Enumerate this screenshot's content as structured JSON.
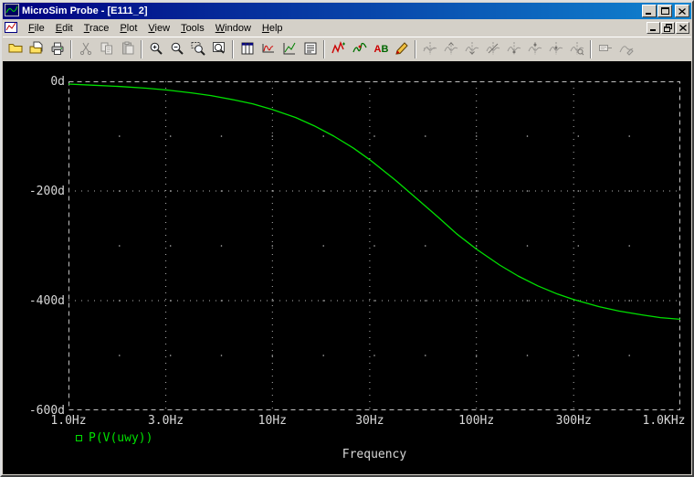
{
  "window": {
    "title": "MicroSim Probe - [E111_2]"
  },
  "menu": {
    "items": [
      "File",
      "Edit",
      "Trace",
      "Plot",
      "View",
      "Tools",
      "Window",
      "Help"
    ]
  },
  "toolbar": {
    "groups": [
      {
        "items": [
          {
            "name": "open",
            "icon": "open-folder"
          },
          {
            "name": "open-file",
            "icon": "open-file"
          },
          {
            "name": "print",
            "icon": "print"
          }
        ]
      },
      {
        "items": [
          {
            "name": "cut",
            "icon": "cut",
            "enabled": false
          },
          {
            "name": "copy",
            "icon": "copy",
            "enabled": false
          },
          {
            "name": "paste",
            "icon": "paste",
            "enabled": false
          }
        ]
      },
      {
        "items": [
          {
            "name": "zoom-in",
            "icon": "zoom-in"
          },
          {
            "name": "zoom-out",
            "icon": "zoom-out"
          },
          {
            "name": "zoom-area",
            "icon": "zoom-area"
          },
          {
            "name": "zoom-fit",
            "icon": "zoom-fit"
          }
        ]
      },
      {
        "items": [
          {
            "name": "plot-columns",
            "icon": "columns"
          },
          {
            "name": "fourier",
            "icon": "fourier"
          },
          {
            "name": "performance-analysis",
            "icon": "xy"
          },
          {
            "name": "data-list",
            "icon": "list"
          }
        ]
      },
      {
        "items": [
          {
            "name": "add-trace",
            "icon": "trace-red"
          },
          {
            "name": "eval-goal-function",
            "icon": "trace-goal"
          },
          {
            "name": "text-label",
            "icon": "ab"
          },
          {
            "name": "mark-point",
            "icon": "pencil"
          }
        ]
      },
      {
        "items": [
          {
            "name": "toggle-cursor",
            "icon": "cursor-toggle",
            "enabled": false
          },
          {
            "name": "cursor-peak",
            "icon": "cursor-peak",
            "enabled": false
          },
          {
            "name": "cursor-trough",
            "icon": "cursor-trough",
            "enabled": false
          },
          {
            "name": "cursor-slope",
            "icon": "cursor-slope",
            "enabled": false
          },
          {
            "name": "cursor-min",
            "icon": "cursor-min",
            "enabled": false
          },
          {
            "name": "cursor-max",
            "icon": "cursor-max",
            "enabled": false
          },
          {
            "name": "cursor-point",
            "icon": "cursor-point",
            "enabled": false
          },
          {
            "name": "cursor-search",
            "icon": "cursor-search",
            "enabled": false
          }
        ]
      },
      {
        "items": [
          {
            "name": "label-point",
            "icon": "tag",
            "enabled": false
          },
          {
            "name": "mark-voltage",
            "icon": "probe-mark",
            "enabled": false
          }
        ]
      }
    ]
  },
  "chart_data": {
    "type": "line",
    "title": "",
    "xlabel": "Frequency",
    "ylabel": "",
    "x_scale": "log",
    "xlim": [
      1,
      1000
    ],
    "ylim": [
      -600,
      0
    ],
    "grid": "dotted",
    "legend_position": "bottom-left",
    "x_ticks": [
      {
        "v": 1,
        "label": "1.0Hz"
      },
      {
        "v": 3,
        "label": "3.0Hz"
      },
      {
        "v": 10,
        "label": "10Hz"
      },
      {
        "v": 30,
        "label": "30Hz"
      },
      {
        "v": 100,
        "label": "100Hz"
      },
      {
        "v": 300,
        "label": "300Hz"
      },
      {
        "v": 1000,
        "label": "1.0KHz"
      }
    ],
    "y_ticks": [
      {
        "v": 0,
        "label": "0d"
      },
      {
        "v": -200,
        "label": "-200d"
      },
      {
        "v": -400,
        "label": "-400d"
      },
      {
        "v": -600,
        "label": "-600d"
      }
    ],
    "series": [
      {
        "name": "P(V(uwy))",
        "color": "#00e000",
        "points": [
          [
            1,
            -5
          ],
          [
            1.3,
            -7
          ],
          [
            1.8,
            -9.5
          ],
          [
            2.4,
            -12.5
          ],
          [
            3,
            -15.6
          ],
          [
            4,
            -21
          ],
          [
            5,
            -26
          ],
          [
            6.5,
            -34
          ],
          [
            8,
            -41
          ],
          [
            10,
            -51.5
          ],
          [
            13,
            -66
          ],
          [
            16,
            -81
          ],
          [
            20,
            -100
          ],
          [
            25,
            -122
          ],
          [
            30,
            -143
          ],
          [
            40,
            -180
          ],
          [
            50,
            -211
          ],
          [
            65,
            -248
          ],
          [
            80,
            -278
          ],
          [
            100,
            -306
          ],
          [
            130,
            -335
          ],
          [
            160,
            -355
          ],
          [
            200,
            -373
          ],
          [
            250,
            -388
          ],
          [
            300,
            -398
          ],
          [
            400,
            -411
          ],
          [
            500,
            -419
          ],
          [
            650,
            -426
          ],
          [
            800,
            -431
          ],
          [
            1000,
            -434
          ]
        ]
      }
    ]
  },
  "legend": {
    "items": [
      {
        "label": "P(V(uwy))",
        "color": "#00e000"
      }
    ]
  },
  "colors": {
    "chrome": "#d4d0c8",
    "plot_bg": "#000000",
    "trace": "#00e000",
    "grid_dots": "#b4b4b4",
    "axis_text": "#d8d8d8",
    "title_gradient_start": "#000080",
    "title_gradient_end": "#1084d0"
  }
}
